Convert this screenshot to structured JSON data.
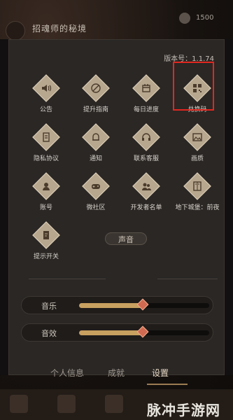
{
  "hud": {
    "quest_title": "招魂师的秘境",
    "currency_value": "1500"
  },
  "panel": {
    "version_label": "版本号：1.1.74"
  },
  "grid": [
    {
      "label": "公告",
      "icon": "speaker-icon"
    },
    {
      "label": "提升指南",
      "icon": "guide-icon"
    },
    {
      "label": "每日进度",
      "icon": "calendar-icon"
    },
    {
      "label": "兑换码",
      "icon": "qr-code-icon",
      "highlighted": true
    },
    {
      "label": "隐私协议",
      "icon": "document-icon"
    },
    {
      "label": "通知",
      "icon": "bell-icon"
    },
    {
      "label": "联系客服",
      "icon": "headset-icon"
    },
    {
      "label": "画质",
      "icon": "image-icon"
    },
    {
      "label": "账号",
      "icon": "account-icon"
    },
    {
      "label": "微社区",
      "icon": "gamepad-icon"
    },
    {
      "label": "开发者名单",
      "icon": "developers-icon"
    },
    {
      "label": "地下城堡：前夜",
      "icon": "book-icon"
    },
    {
      "label": "提示开关",
      "icon": "notice-toggle-icon"
    }
  ],
  "sound": {
    "title": "声音",
    "music_label": "音乐",
    "music_level": 0.49,
    "sfx_label": "音效",
    "sfx_level": 0.49
  },
  "tabs": [
    {
      "label": "个人信息"
    },
    {
      "label": "成就"
    },
    {
      "label": "设置",
      "active": true
    }
  ],
  "watermark": "脉冲手游网",
  "colors": {
    "highlight": "#e2271f",
    "accent": "#c8a060"
  }
}
